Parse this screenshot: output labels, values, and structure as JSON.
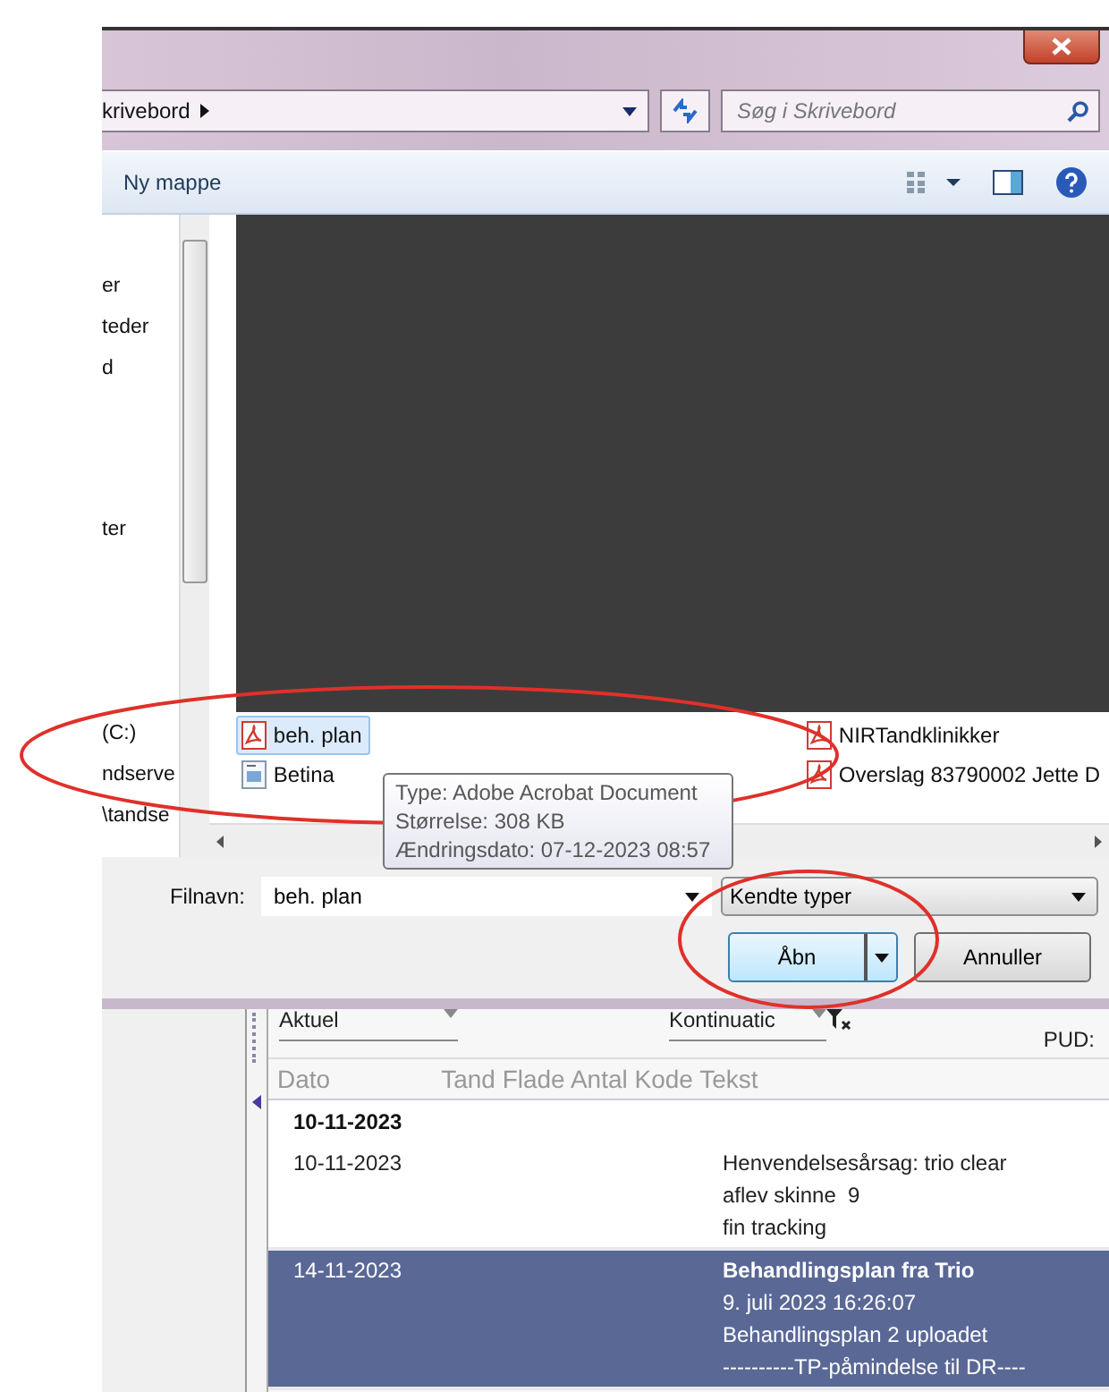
{
  "dialog": {
    "address": {
      "path": "krivebord",
      "search_placeholder": "Søg i Skrivebord"
    },
    "toolbar": {
      "new_folder": "Ny mappe"
    },
    "nav": {
      "favorites": [
        "er",
        "teder",
        "d"
      ],
      "middle": [
        "ter"
      ],
      "drives": [
        "(C:)",
        "ndserve",
        "\\tandse"
      ]
    },
    "files": [
      {
        "name": "beh. plan",
        "kind": "pdf",
        "selected": true
      },
      {
        "name": "Betina",
        "kind": "doc",
        "selected": false
      },
      {
        "name": "NIRTandklinikker",
        "kind": "pdf",
        "selected": false
      },
      {
        "name": "Overslag 83790002 Jette D",
        "kind": "pdf",
        "selected": false
      }
    ],
    "tooltip": [
      "Type: Adobe Acrobat Document",
      "Størrelse: 308 KB",
      "Ændringsdato: 07-12-2023 08:57"
    ],
    "filename": {
      "label": "Filnavn:",
      "value": "beh. plan"
    },
    "filter": "Kendte typer",
    "buttons": {
      "open": "Åbn",
      "cancel": "Annuller"
    }
  },
  "journal": {
    "view": "Aktuel",
    "type": "Kontinuatic",
    "pud": "PUD:",
    "columns": [
      "Dato",
      "Tand Flade Antal Kode Tekst"
    ],
    "group": "10-11-2023",
    "entries": [
      {
        "date": "10-11-2023",
        "lines": [
          "Henvendelsesårsag: trio clear",
          "aflev skinne  9",
          "fin tracking"
        ],
        "selected": false
      },
      {
        "date": "14-11-2023",
        "title": "Behandlingsplan fra Trio",
        "lines": [
          "9. juli 2023 16:26:07",
          "Behandlingsplan 2 uploadet",
          "----------TP-påmindelse til DR----"
        ],
        "selected": true
      }
    ]
  }
}
